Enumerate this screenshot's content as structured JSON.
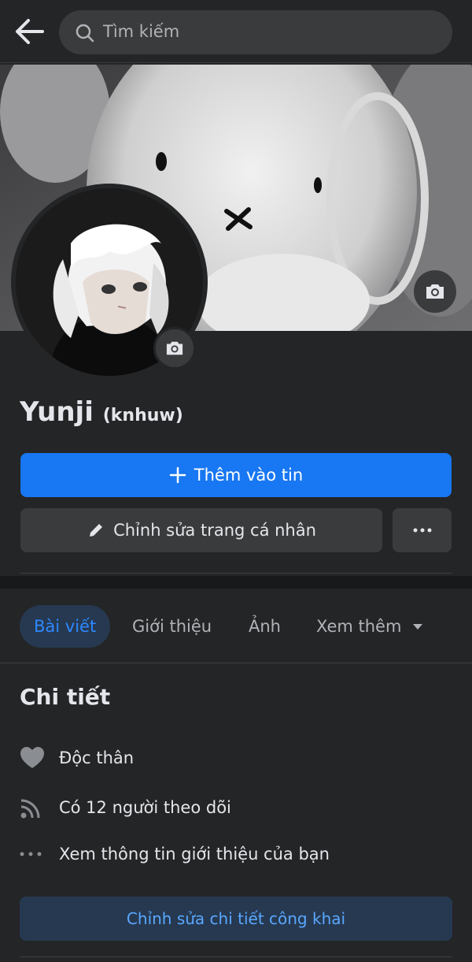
{
  "search": {
    "placeholder": "Tìm kiếm"
  },
  "profile": {
    "name": "Yunji",
    "alternate_name": "(knhuw)"
  },
  "actions": {
    "add_story": "Thêm vào tin",
    "edit_profile": "Chỉnh sửa trang cá nhân"
  },
  "tabs": [
    {
      "label": "Bài viết",
      "active": true
    },
    {
      "label": "Giới thiệu"
    },
    {
      "label": "Ảnh"
    },
    {
      "label": "Xem thêm"
    }
  ],
  "details": {
    "title": "Chi tiết",
    "items": [
      {
        "icon": "heart-icon",
        "text": "Độc thân"
      },
      {
        "icon": "rss-icon",
        "text": "Có 12 người theo dõi"
      },
      {
        "icon": "more-dots-icon",
        "text": "Xem thông tin giới thiệu của bạn"
      }
    ],
    "edit_public": "Chỉnh sửa chi tiết công khai"
  },
  "colors": {
    "accent": "#1877f2",
    "background": "#242526",
    "tab_active_bg": "#263951"
  }
}
